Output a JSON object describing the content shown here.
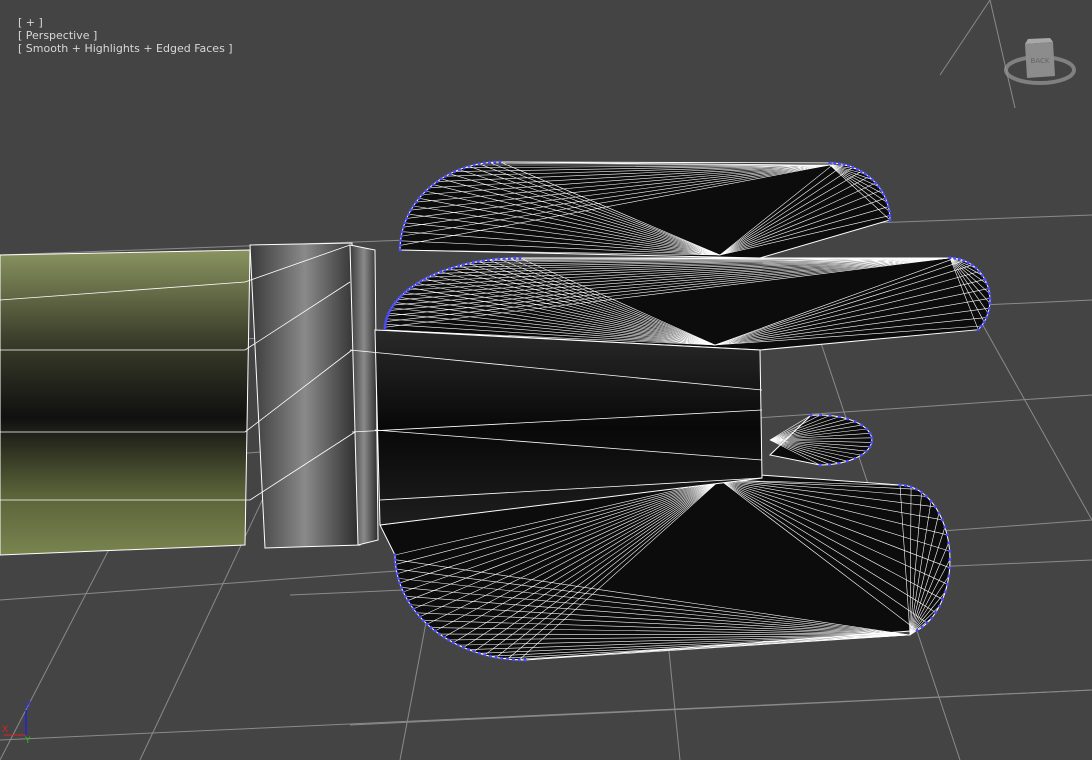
{
  "viewport": {
    "menu_plus": "[ + ]",
    "view_name": "[ Perspective ]",
    "shading_mode": "[ Smooth + Highlights + Edged Faces ]"
  },
  "viewcube": {
    "face_label": "BACK",
    "icon": "viewcube-icon"
  },
  "axis_gizmo": {
    "x": "X",
    "y": "Y",
    "z": "Z"
  },
  "colors": {
    "background": "#444444",
    "grid": "#8a8a8a",
    "vertex": "#4a4aff",
    "edge": "#ffffff",
    "axis_x": "#e02020",
    "axis_y": "#20c020",
    "axis_z": "#2020e0"
  }
}
